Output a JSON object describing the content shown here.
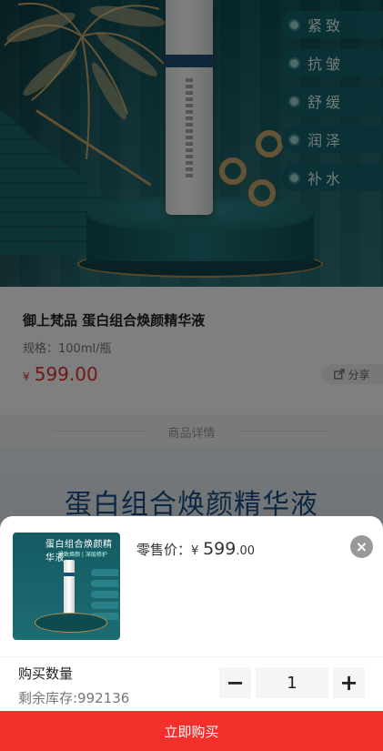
{
  "features": [
    "紧致",
    "抗皱",
    "舒缓",
    "润泽",
    "补水"
  ],
  "product": {
    "title": "御上梵品 蛋白组合焕颜精华液",
    "spec": "规格：100ml/瓶",
    "price_symbol": "¥",
    "price": "599.00",
    "share_label": "分享"
  },
  "section": {
    "label": "商品详情"
  },
  "detail": {
    "heading": "蛋白组合焕颜精华液"
  },
  "sheet": {
    "thumb_title": "蛋白组合焕颜精华液",
    "thumb_subtitle": "紧致焕颜 | 深层修护",
    "retail_label": "零售价：",
    "retail_symbol": "¥",
    "retail_int": "599",
    "retail_dec": ".00",
    "close_icon": "×",
    "qty_label": "购买数量",
    "stock": "剩余库存:992136",
    "minus": "−",
    "quantity": "1",
    "plus": "+",
    "buy_label": "立即购买"
  },
  "colors": {
    "accent": "#f3302b",
    "price": "#e0322e",
    "teal": "#145a62"
  }
}
